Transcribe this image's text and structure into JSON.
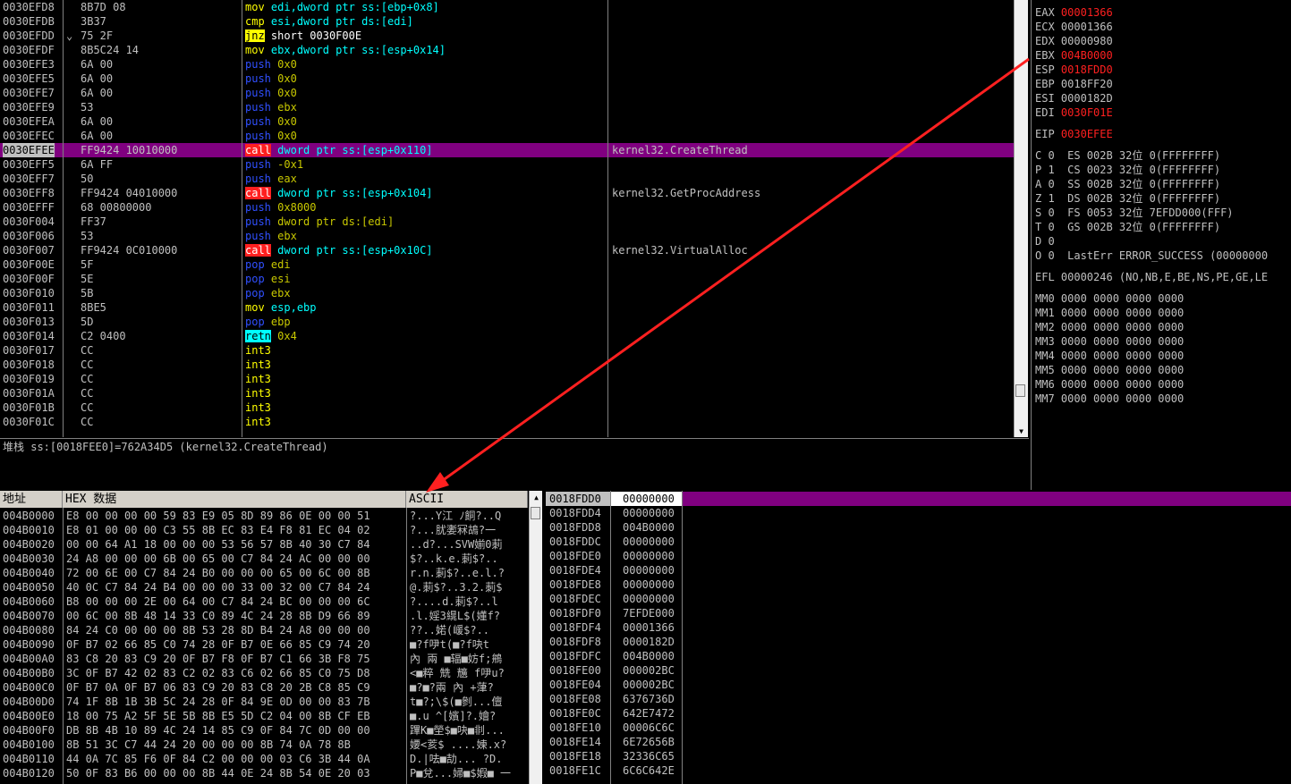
{
  "disasm": {
    "rows": [
      {
        "addr": "0030EFD8",
        "hex": "8B7D 08",
        "mark": "",
        "mn": "mov",
        "mn_cls": "m-mov",
        "op": "edi,dword ptr ss:[ebp+0x8]",
        "op_cls": "op-default",
        "comment": ""
      },
      {
        "addr": "0030EFDB",
        "hex": "3B37",
        "mark": "",
        "mn": "cmp",
        "mn_cls": "m-cmp",
        "op": "esi,dword ptr ds:[edi]",
        "op_cls": "op-default",
        "comment": ""
      },
      {
        "addr": "0030EFDD",
        "hex": "75 2F",
        "mark": "⌄",
        "mn": "jnz",
        "mn_cls": "m-jnz",
        "op": "short 0030F00E",
        "op_cls": "op-jnz",
        "comment": ""
      },
      {
        "addr": "0030EFDF",
        "hex": "8B5C24 14",
        "mark": "",
        "mn": "mov",
        "mn_cls": "m-mov",
        "op": "ebx,dword ptr ss:[esp+0x14]",
        "op_cls": "op-default",
        "comment": ""
      },
      {
        "addr": "0030EFE3",
        "hex": "6A 00",
        "mark": "",
        "mn": "push",
        "mn_cls": "m-push",
        "op": "0x0",
        "op_cls": "op-imm",
        "comment": ""
      },
      {
        "addr": "0030EFE5",
        "hex": "6A 00",
        "mark": "",
        "mn": "push",
        "mn_cls": "m-push",
        "op": "0x0",
        "op_cls": "op-imm",
        "comment": ""
      },
      {
        "addr": "0030EFE7",
        "hex": "6A 00",
        "mark": "",
        "mn": "push",
        "mn_cls": "m-push",
        "op": "0x0",
        "op_cls": "op-imm",
        "comment": ""
      },
      {
        "addr": "0030EFE9",
        "hex": "53",
        "mark": "",
        "mn": "push",
        "mn_cls": "m-push",
        "op": "ebx",
        "op_cls": "op-imm",
        "comment": ""
      },
      {
        "addr": "0030EFEA",
        "hex": "6A 00",
        "mark": "",
        "mn": "push",
        "mn_cls": "m-push",
        "op": "0x0",
        "op_cls": "op-imm",
        "comment": ""
      },
      {
        "addr": "0030EFEC",
        "hex": "6A 00",
        "mark": "",
        "mn": "push",
        "mn_cls": "m-push",
        "op": "0x0",
        "op_cls": "op-imm",
        "comment": ""
      },
      {
        "addr": "0030EFEE",
        "hex": "FF9424 10010000",
        "mark": "",
        "mn": "call",
        "mn_cls": "m-call",
        "op": "dword ptr ss:[esp+0x110]",
        "op_cls": "op-default",
        "comment": "kernel32.CreateThread",
        "selected": true
      },
      {
        "addr": "0030EFF5",
        "hex": "6A FF",
        "mark": "",
        "mn": "push",
        "mn_cls": "m-push",
        "op": "-0x1",
        "op_cls": "op-imm",
        "comment": ""
      },
      {
        "addr": "0030EFF7",
        "hex": "50",
        "mark": "",
        "mn": "push",
        "mn_cls": "m-push",
        "op": "eax",
        "op_cls": "op-imm",
        "comment": ""
      },
      {
        "addr": "0030EFF8",
        "hex": "FF9424 04010000",
        "mark": "",
        "mn": "call",
        "mn_cls": "m-call",
        "op": "dword ptr ss:[esp+0x104]",
        "op_cls": "op-default",
        "comment": "kernel32.GetProcAddress"
      },
      {
        "addr": "0030EFFF",
        "hex": "68 00800000",
        "mark": "",
        "mn": "push",
        "mn_cls": "m-push",
        "op": "0x8000",
        "op_cls": "op-imm",
        "comment": ""
      },
      {
        "addr": "0030F004",
        "hex": "FF37",
        "mark": "",
        "mn": "push",
        "mn_cls": "m-push",
        "op": "dword ptr ds:[edi]",
        "op_cls": "op-imm",
        "comment": ""
      },
      {
        "addr": "0030F006",
        "hex": "53",
        "mark": "",
        "mn": "push",
        "mn_cls": "m-push",
        "op": "ebx",
        "op_cls": "op-imm",
        "comment": ""
      },
      {
        "addr": "0030F007",
        "hex": "FF9424 0C010000",
        "mark": "",
        "mn": "call",
        "mn_cls": "m-call",
        "op": "dword ptr ss:[esp+0x10C]",
        "op_cls": "op-default",
        "comment": "kernel32.VirtualAlloc"
      },
      {
        "addr": "0030F00E",
        "hex": "5F",
        "mark": "",
        "mn": "pop",
        "mn_cls": "m-pop",
        "op": "edi",
        "op_cls": "op-imm",
        "comment": ""
      },
      {
        "addr": "0030F00F",
        "hex": "5E",
        "mark": "",
        "mn": "pop",
        "mn_cls": "m-pop",
        "op": "esi",
        "op_cls": "op-imm",
        "comment": ""
      },
      {
        "addr": "0030F010",
        "hex": "5B",
        "mark": "",
        "mn": "pop",
        "mn_cls": "m-pop",
        "op": "ebx",
        "op_cls": "op-imm",
        "comment": ""
      },
      {
        "addr": "0030F011",
        "hex": "8BE5",
        "mark": "",
        "mn": "mov",
        "mn_cls": "m-mov",
        "op": "esp,ebp",
        "op_cls": "op-default",
        "comment": ""
      },
      {
        "addr": "0030F013",
        "hex": "5D",
        "mark": "",
        "mn": "pop",
        "mn_cls": "m-pop",
        "op": "ebp",
        "op_cls": "op-imm",
        "comment": ""
      },
      {
        "addr": "0030F014",
        "hex": "C2 0400",
        "mark": "",
        "mn": "retn",
        "mn_cls": "m-retn",
        "op": "0x4",
        "op_cls": "op-imm",
        "comment": ""
      },
      {
        "addr": "0030F017",
        "hex": "CC",
        "mark": "",
        "mn": "int3",
        "mn_cls": "m-int3",
        "op": "",
        "op_cls": "op-imm",
        "comment": ""
      },
      {
        "addr": "0030F018",
        "hex": "CC",
        "mark": "",
        "mn": "int3",
        "mn_cls": "m-int3",
        "op": "",
        "op_cls": "op-imm",
        "comment": ""
      },
      {
        "addr": "0030F019",
        "hex": "CC",
        "mark": "",
        "mn": "int3",
        "mn_cls": "m-int3",
        "op": "",
        "op_cls": "op-imm",
        "comment": ""
      },
      {
        "addr": "0030F01A",
        "hex": "CC",
        "mark": "",
        "mn": "int3",
        "mn_cls": "m-int3",
        "op": "",
        "op_cls": "op-imm",
        "comment": ""
      },
      {
        "addr": "0030F01B",
        "hex": "CC",
        "mark": "",
        "mn": "int3",
        "mn_cls": "m-int3",
        "op": "",
        "op_cls": "op-imm",
        "comment": ""
      },
      {
        "addr": "0030F01C",
        "hex": "CC",
        "mark": "",
        "mn": "int3",
        "mn_cls": "m-int3",
        "op": "",
        "op_cls": "op-imm",
        "comment": ""
      }
    ]
  },
  "info": {
    "line": "堆栈 ss:[0018FEE0]=762A34D5 (kernel32.CreateThread)"
  },
  "registers": {
    "gp": [
      {
        "name": "EAX",
        "value": "00001366",
        "changed": true
      },
      {
        "name": "ECX",
        "value": "00001366",
        "changed": false
      },
      {
        "name": "EDX",
        "value": "00000980",
        "changed": false
      },
      {
        "name": "EBX",
        "value": "004B0000",
        "changed": true
      },
      {
        "name": "ESP",
        "value": "0018FDD0",
        "changed": true
      },
      {
        "name": "EBP",
        "value": "0018FF20",
        "changed": false
      },
      {
        "name": "ESI",
        "value": "0000182D",
        "changed": false
      },
      {
        "name": "EDI",
        "value": "0030F01E",
        "changed": true
      }
    ],
    "eip": {
      "name": "EIP",
      "value": "0030EFEE",
      "changed": true
    },
    "flags": [
      "C 0  ES 002B 32位 0(FFFFFFFF)",
      "P 1  CS 0023 32位 0(FFFFFFFF)",
      "A 0  SS 002B 32位 0(FFFFFFFF)",
      "Z 1  DS 002B 32位 0(FFFFFFFF)",
      "S 0  FS 0053 32位 7EFDD000(FFF)",
      "T 0  GS 002B 32位 0(FFFFFFFF)",
      "D 0",
      "O 0  LastErr ERROR_SUCCESS (00000000"
    ],
    "efl": "EFL 00000246 (NO,NB,E,BE,NS,PE,GE,LE",
    "mmx": [
      "MM0 0000 0000 0000 0000",
      "MM1 0000 0000 0000 0000",
      "MM2 0000 0000 0000 0000",
      "MM3 0000 0000 0000 0000",
      "MM4 0000 0000 0000 0000",
      "MM5 0000 0000 0000 0000",
      "MM6 0000 0000 0000 0000",
      "MM7 0000 0000 0000 0000"
    ]
  },
  "dump": {
    "headers": {
      "addr": "地址",
      "hex": "HEX 数据",
      "ascii": "ASCII"
    },
    "rows": [
      {
        "addr": "004B0000",
        "hex": "E8 00 00 00 00 59 83 E9 05 8D 89 86 0E 00 00 51",
        "ascii": "?...Y江 ﾉ餇?..Q"
      },
      {
        "addr": "004B0010",
        "hex": "E8 01 00 00 00 C3 55 8B EC 83 E4 F8 81 EC 04 02",
        "ascii": "?...肬嬱冧鴣?⼀"
      },
      {
        "addr": "004B0020",
        "hex": "00 00 64 A1 18 00 00 00 53 56 57 8B 40 30 C7 84",
        "ascii": "..d?...SVW媊0莿"
      },
      {
        "addr": "004B0030",
        "hex": "24 A8 00 00 00 6B 00 65 00 C7 84 24 AC 00 00 00",
        "ascii": "$?..k.e.莿$?.."
      },
      {
        "addr": "004B0040",
        "hex": "72 00 6E 00 C7 84 24 B0 00 00 00 65 00 6C 00 8B",
        "ascii": "r.n.莿$?..e.l.?"
      },
      {
        "addr": "004B0050",
        "hex": "40 0C C7 84 24 B4 00 00 00 33 00 32 00 C7 84 24",
        "ascii": "@.莿$?..3.2.莿$"
      },
      {
        "addr": "004B0060",
        "hex": "B8 00 00 00 2E 00 64 00 C7 84 24 BC 00 00 00 6C",
        "ascii": "?....d.莿$?..l"
      },
      {
        "addr": "004B0070",
        "hex": "00 6C 00 8B 48 14 33 C0 89 4C 24 28 8B D9 66 89",
        "ascii": ".l.婬3繉L$(嬞f?"
      },
      {
        "addr": "004B0080",
        "hex": "84 24 C0 00 00 00 8B 53 28 8D B4 24 A8 00 00 00",
        "ascii": "??..婼(嵈$?.."
      },
      {
        "addr": "004B0090",
        "hex": "0F B7 02 66 85 C0 74 28 0F B7 0E 66 85 C9 74 20",
        "ascii": "■?f吚t(■?f吷t"
      },
      {
        "addr": "004B00A0",
        "hex": "83 C8 20 83 C9 20 0F B7 F8 0F B7 C1 66 3B F8 75",
        "ascii": "內 兩 ■辐■妨f;鴘"
      },
      {
        "addr": "004B00B0",
        "hex": "3C 0F B7 42 02 83 C2 02 83 C6 02 66 85 C0 75 D8",
        "ascii": "<■粹 兟 兤 f吚u?"
      },
      {
        "addr": "004B00C0",
        "hex": "0F B7 0A 0F B7 06 83 C9 20 83 C8 20 2B C8 85 C9",
        "ascii": "■?■?兩 內 +葏?"
      },
      {
        "addr": "004B00D0",
        "hex": "74 1F 8B 1B 3B 5C 24 28 0F 84 9E 0D 00 00 83 7B",
        "ascii": "t■?;\\$(■剼...儃"
      },
      {
        "addr": "004B00E0",
        "hex": "18 00 75 A2 5F 5E 5B 8B E5 5D C2 04 00 8B CF EB",
        "ascii": "■.u ^[嬪]?.嬒?"
      },
      {
        "addr": "004B00F0",
        "hex": "DB 8B 4B 10 89 4C 24 14 85 C9 0F 84 7C 0D 00 00",
        "ascii": "蹕K■塋$■吷■剕..."
      },
      {
        "addr": "004B0100",
        "hex": "8B 51 3C C7 44 24 20 00 00 00 8B 74 0A 78 8B",
        "ascii": "婹<荄$ ....媡.x?"
      },
      {
        "addr": "004B0110",
        "hex": "44 0A 7C 85 F6 0F 84 C2 00 00 00 03 C6 3B 44 0A",
        "ascii": "D.|呿■劼... ?D."
      },
      {
        "addr": "004B0120",
        "hex": "50 0F 83 B6 00 00 00 8B 44 0E 24 8B 54 0E 20 03",
        "ascii": "P■兌...婦■$婽■ ⼀"
      }
    ]
  },
  "stack": {
    "rows": [
      {
        "addr": "0018FDD0",
        "val": "00000000",
        "selected": true
      },
      {
        "addr": "0018FDD4",
        "val": "00000000"
      },
      {
        "addr": "0018FDD8",
        "val": "004B0000"
      },
      {
        "addr": "0018FDDC",
        "val": "00000000"
      },
      {
        "addr": "0018FDE0",
        "val": "00000000"
      },
      {
        "addr": "0018FDE4",
        "val": "00000000"
      },
      {
        "addr": "0018FDE8",
        "val": "00000000"
      },
      {
        "addr": "0018FDEC",
        "val": "00000000"
      },
      {
        "addr": "0018FDF0",
        "val": "7EFDE000"
      },
      {
        "addr": "0018FDF4",
        "val": "00001366"
      },
      {
        "addr": "0018FDF8",
        "val": "0000182D"
      },
      {
        "addr": "0018FDFC",
        "val": "004B0000"
      },
      {
        "addr": "0018FE00",
        "val": "000002BC"
      },
      {
        "addr": "0018FE04",
        "val": "000002BC"
      },
      {
        "addr": "0018FE08",
        "val": "6376736D"
      },
      {
        "addr": "0018FE0C",
        "val": "642E7472"
      },
      {
        "addr": "0018FE10",
        "val": "00006C6C"
      },
      {
        "addr": "0018FE14",
        "val": "6E72656B"
      },
      {
        "addr": "0018FE18",
        "val": "32336C65"
      },
      {
        "addr": "0018FE1C",
        "val": "6C6C642E"
      }
    ]
  },
  "colors": {
    "selection": "#800080",
    "changed": "#ff2020",
    "call": "#ff2020",
    "jnz": "#ffff00",
    "retn": "#00ffff",
    "arrow": "#ff2020"
  }
}
